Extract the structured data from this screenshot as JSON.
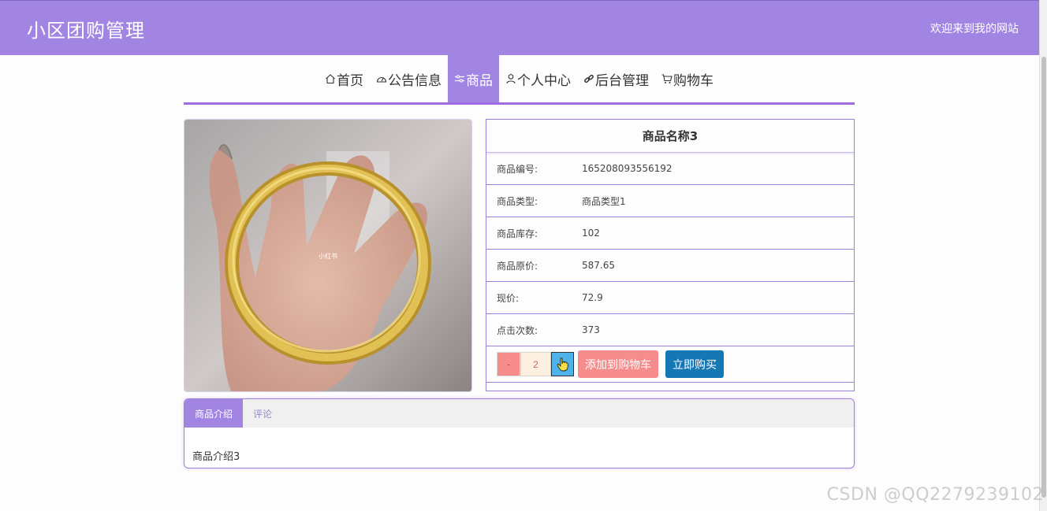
{
  "header": {
    "title": "小区团购管理",
    "welcome": "欢迎来到我的网站"
  },
  "nav": {
    "items": [
      {
        "label": "首页",
        "icon": "home-icon"
      },
      {
        "label": "公告信息",
        "icon": "gauge-icon"
      },
      {
        "label": "商品",
        "icon": "sliders-icon",
        "active": true
      },
      {
        "label": "个人中心",
        "icon": "user-icon"
      },
      {
        "label": "后台管理",
        "icon": "link-icon"
      },
      {
        "label": "购物车",
        "icon": "cart-icon"
      }
    ]
  },
  "product": {
    "image_text": "小红书",
    "name": "商品名称3",
    "fields": [
      {
        "label": "商品编号:",
        "value": "165208093556192"
      },
      {
        "label": "商品类型:",
        "value": "商品类型1"
      },
      {
        "label": "商品库存:",
        "value": "102"
      },
      {
        "label": "商品原价:",
        "value": "587.65"
      },
      {
        "label": "现价:",
        "value": "72.9"
      },
      {
        "label": "点击次数:",
        "value": "373"
      }
    ],
    "minus_label": "-",
    "quantity": "2",
    "add_to_cart": "添加到购物车",
    "buy_now": "立即购买"
  },
  "tabs": {
    "items": [
      {
        "label": "商品介绍",
        "active": true
      },
      {
        "label": "评论",
        "active": false
      }
    ],
    "content": "商品介绍3"
  },
  "watermark": "CSDN @QQ2279239102",
  "colors": {
    "accent": "#a285e3",
    "border": "#9b7fd8",
    "cart_button": "#f78c8c",
    "buy_button": "#1677b6",
    "plus_button": "#4fb3ea"
  }
}
